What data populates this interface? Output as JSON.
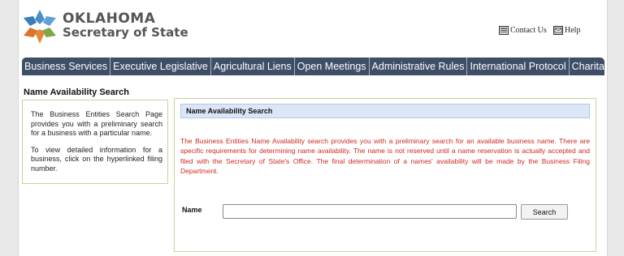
{
  "header": {
    "brand_line1": "OKLAHOMA",
    "brand_line2": "Secretary of State",
    "contact_label": "Contact Us",
    "help_label": "Help"
  },
  "nav": {
    "items": [
      {
        "label": "Business Services"
      },
      {
        "label": "Executive Legislative"
      },
      {
        "label": "Agricultural Liens"
      },
      {
        "label": "Open Meetings"
      },
      {
        "label": "Administrative Rules"
      },
      {
        "label": "International Protocol"
      },
      {
        "label": "Charitable Organizations"
      }
    ]
  },
  "sidebar": {
    "title": "Name Availability Search",
    "paragraph1": "The Business Entities Search Page provides you with a preliminary search for a business with a particular name.",
    "paragraph2": "To view detailed information for a business, click on the hyperlinked filing number."
  },
  "main": {
    "title": "Name Availability Search",
    "notice": "The Business Entities Name Availability search provides you with a preliminary search for an available business name. There are specific requirements for determining name availability. The name is not reserved until a name reservation is actually accepted and filed with the Secretary of State's Office. The final determination of a names' availability will be made by the Business Filing Department.",
    "name_label": "Name",
    "name_value": "",
    "search_label": "Search"
  },
  "colors": {
    "nav_bg": "#3e4e66",
    "notice_text": "#cc2a1e",
    "title_bar": "#dbe6f7"
  }
}
